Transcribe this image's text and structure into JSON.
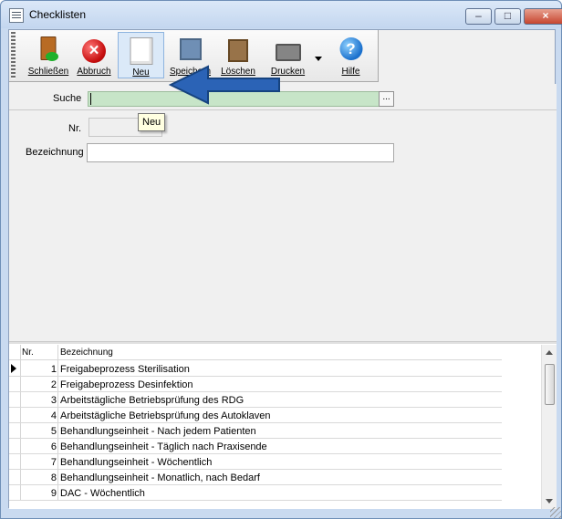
{
  "window": {
    "title": "Checklisten"
  },
  "toolbar": {
    "buttons": [
      {
        "label": "Schließen",
        "icon": "door-exit-icon"
      },
      {
        "label": "Abbruch",
        "icon": "cancel-icon"
      },
      {
        "label": "Neu",
        "icon": "new-document-icon"
      },
      {
        "label": "Speichern",
        "icon": "save-icon"
      },
      {
        "label": "Löschen",
        "icon": "delete-icon"
      },
      {
        "label": "Drucken",
        "icon": "printer-icon"
      },
      {
        "label": "Hilfe",
        "icon": "help-icon"
      }
    ],
    "tooltip": "Neu"
  },
  "search": {
    "label": "Suche",
    "value": "",
    "button": "..."
  },
  "form": {
    "nr_label": "Nr.",
    "bezeichnung_label": "Bezeichnung"
  },
  "table": {
    "headers": [
      "Nr.",
      "Bezeichnung"
    ],
    "rows": [
      {
        "nr": "1",
        "desc": "Freigabeprozess Sterilisation"
      },
      {
        "nr": "2",
        "desc": "Freigabeprozess Desinfektion"
      },
      {
        "nr": "3",
        "desc": "Arbeitstägliche Betriebsprüfung des RDG"
      },
      {
        "nr": "4",
        "desc": "Arbeitstägliche Betriebsprüfung des Autoklaven"
      },
      {
        "nr": "5",
        "desc": "Behandlungseinheit - Nach jedem Patienten"
      },
      {
        "nr": "6",
        "desc": "Behandlungseinheit - Täglich nach Praxisende"
      },
      {
        "nr": "7",
        "desc": "Behandlungseinheit - Wöchentlich"
      },
      {
        "nr": "8",
        "desc": "Behandlungseinheit - Monatlich, nach Bedarf"
      },
      {
        "nr": "9",
        "desc": "DAC - Wöchentlich"
      }
    ]
  },
  "colors": {
    "accent": "#2b63b6",
    "search_field": "#c7e5c8"
  }
}
